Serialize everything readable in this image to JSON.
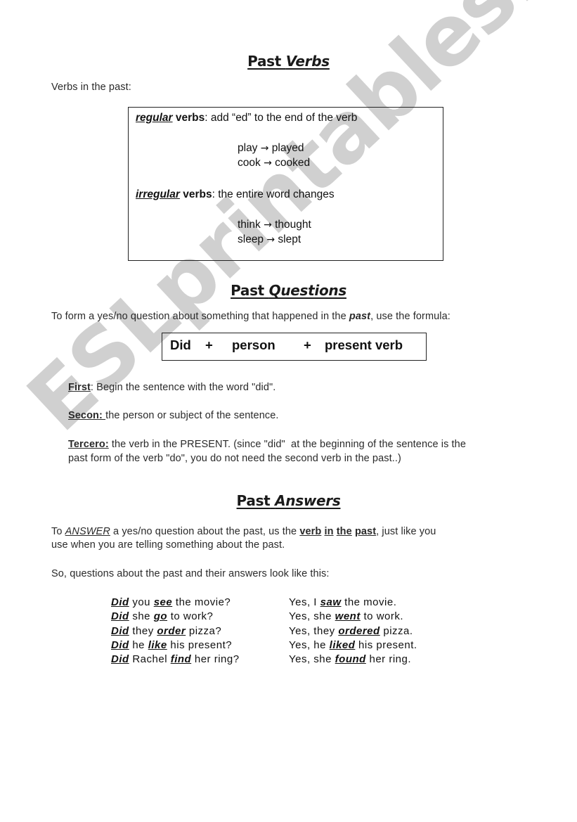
{
  "watermark": "ESLprintables.com",
  "section_verbs": {
    "title_plain": "Past",
    "title_italic": "Verbs",
    "intro": "Verbs in the past:",
    "box": {
      "regular_label": "regular",
      "regular_verbs_word": "verbs",
      "regular_rule": ": add “ed” to the end of the verb",
      "regular_examples": [
        {
          "base": "play",
          "arrow": "→",
          "past": "played"
        },
        {
          "base": "cook",
          "arrow": "→",
          "past": "cooked"
        }
      ],
      "irregular_label": "irregular",
      "irregular_verbs_word": "verbs",
      "irregular_rule": ": the entire word changes",
      "irregular_examples": [
        {
          "base": "think",
          "arrow": "→",
          "past": "thought"
        },
        {
          "base": "sleep",
          "arrow": "→",
          "past": "slept"
        }
      ]
    }
  },
  "section_questions": {
    "title_plain": "Past",
    "title_italic": "Questions",
    "intro_before": "To form a yes/no question about something that happened in the ",
    "intro_emph": "past",
    "intro_after": ", use the formula:",
    "formula": {
      "part1": "Did",
      "plus1": "+",
      "part2": "person",
      "plus2": "+",
      "part3": "present verb"
    },
    "steps": [
      {
        "label": "First",
        "text": ": Begin the sentence with the word \"did\"."
      },
      {
        "label": "Secon: ",
        "text": "the person or subject of the sentence."
      },
      {
        "label": "Tercero:",
        "text": " the verb in the PRESENT. (since \"did\"  at the beginning of the sentence is the",
        "text2": "past form of the verb \"do\", you do not need the second verb in the past..)"
      }
    ]
  },
  "section_answers": {
    "title_plain": "Past",
    "title_italic": "Answers",
    "para1_to": "To ",
    "para1_answer": "ANSWER",
    "para1_mid": " a yes/no question about the past, us the ",
    "para1_emph": [
      "verb",
      "in",
      "the",
      "past"
    ],
    "para1_end": ", just like you",
    "para1_line2": "use when you are telling something about the past.",
    "para2": "So, questions about the past and their answers look like this:",
    "examples": [
      {
        "q_did": "Did",
        "q_pre": " you ",
        "q_verb": "see",
        "q_post": " the movie?",
        "a_pre": "Yes, I ",
        "a_verb": "saw",
        "a_post": " the movie."
      },
      {
        "q_did": "Did",
        "q_pre": " she ",
        "q_verb": "go",
        "q_post": " to work?",
        "a_pre": "Yes, she ",
        "a_verb": "went",
        "a_post": " to work."
      },
      {
        "q_did": "Did",
        "q_pre": " they ",
        "q_verb": "order",
        "q_post": " pizza?",
        "a_pre": "Yes, they ",
        "a_verb": "ordered",
        "a_post": " pizza."
      },
      {
        "q_did": "Did",
        "q_pre": " he ",
        "q_verb": "like",
        "q_post": " his present?",
        "a_pre": "Yes, he ",
        "a_verb": "liked",
        "a_post": " his present."
      },
      {
        "q_did": "Did",
        "q_pre": " Rachel ",
        "q_verb": "find",
        "q_post": " her ring?",
        "a_pre": "Yes, she ",
        "a_verb": "found",
        "a_post": " her ring."
      }
    ]
  }
}
